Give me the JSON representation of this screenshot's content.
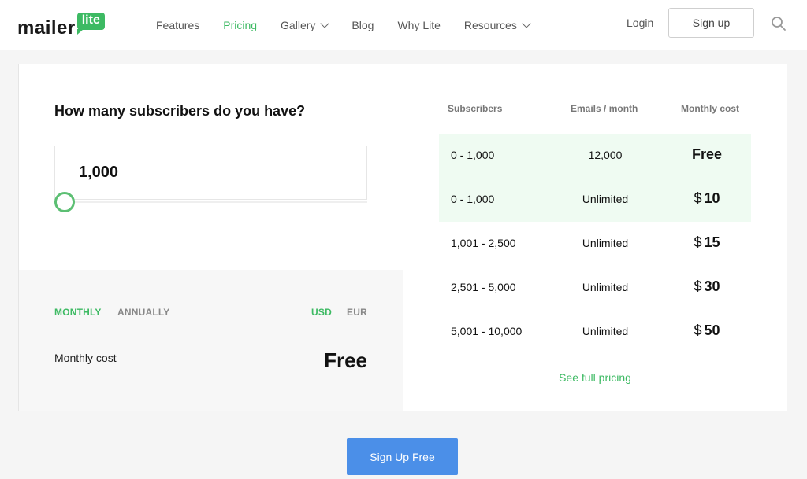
{
  "header": {
    "logo_text": "mailer",
    "logo_badge": "lite",
    "nav": [
      {
        "label": "Features",
        "active": false,
        "dropdown": false
      },
      {
        "label": "Pricing",
        "active": true,
        "dropdown": false
      },
      {
        "label": "Gallery",
        "active": false,
        "dropdown": true
      },
      {
        "label": "Blog",
        "active": false,
        "dropdown": false
      },
      {
        "label": "Why Lite",
        "active": false,
        "dropdown": false
      },
      {
        "label": "Resources",
        "active": false,
        "dropdown": true
      }
    ],
    "login_label": "Login",
    "signup_label": "Sign up",
    "search_icon": "search-icon"
  },
  "calculator": {
    "question": "How many subscribers do you have?",
    "subscriber_count": "1,000",
    "slider_value": 0,
    "billing": {
      "monthly": "MONTHLY",
      "annually": "ANNUALLY",
      "selected": "monthly"
    },
    "currency": {
      "usd": "USD",
      "eur": "EUR",
      "selected": "usd"
    },
    "cost_label": "Monthly cost",
    "cost_value": "Free"
  },
  "pricing_table": {
    "headers": {
      "subscribers": "Subscribers",
      "emails": "Emails / month",
      "cost": "Monthly cost"
    },
    "rows": [
      {
        "subscribers": "0 - 1,000",
        "emails": "12,000",
        "currency": "",
        "cost": "Free",
        "highlight": true
      },
      {
        "subscribers": "0 - 1,000",
        "emails": "Unlimited",
        "currency": "$",
        "cost": "10",
        "highlight": true
      },
      {
        "subscribers": "1,001 - 2,500",
        "emails": "Unlimited",
        "currency": "$",
        "cost": "15",
        "highlight": false
      },
      {
        "subscribers": "2,501 - 5,000",
        "emails": "Unlimited",
        "currency": "$",
        "cost": "30",
        "highlight": false
      },
      {
        "subscribers": "5,001 - 10,000",
        "emails": "Unlimited",
        "currency": "$",
        "cost": "50",
        "highlight": false
      }
    ],
    "full_pricing_link": "See full pricing"
  },
  "cta_label": "Sign Up Free",
  "colors": {
    "accent_green": "#3dba63",
    "cta_blue": "#4b8fe8",
    "highlight_row": "#effbf2"
  }
}
